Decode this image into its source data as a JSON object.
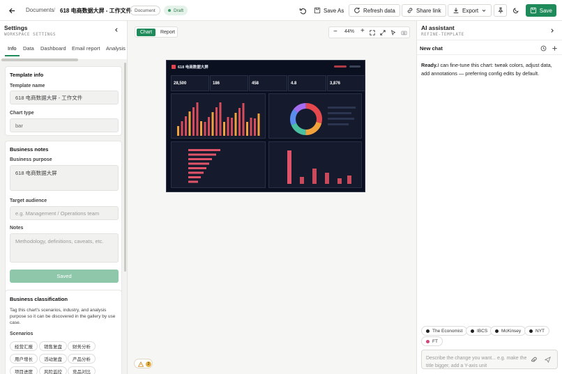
{
  "topbar": {
    "breadcrumb_root": "Documents",
    "separator": "/",
    "doc_title": "618 电商数据大屏 - 工作文件",
    "doc_type_badge": "Document",
    "status_badge": "Draft",
    "save_as_label": "Save As",
    "refresh_label": "Refresh data",
    "share_label": "Share link",
    "export_label": "Export",
    "save_label": "Save"
  },
  "left_panel": {
    "title": "Settings",
    "subtitle": "WORKSPACE SETTINGS",
    "tabs": [
      "Info",
      "Data",
      "Dashboard",
      "Email report",
      "Analysis"
    ],
    "template_info": {
      "heading": "Template info",
      "name_label": "Template name",
      "name_value": "618 电商数据大屏 - 工作文件",
      "type_label": "Chart type",
      "type_value": "bar"
    },
    "business_notes": {
      "heading": "Business notes",
      "purpose_label": "Business purpose",
      "purpose_value": "618 电商数据大屏",
      "audience_label": "Target audience",
      "audience_placeholder": "e.g. Management / Operations team",
      "notes_label": "Notes",
      "notes_placeholder": "Methodology, definitions, caveats, etc.",
      "saved_label": "Saved"
    },
    "classification": {
      "heading": "Business classification",
      "description": "Tag this chart's scenarios, industry, and analysis purpose so it can be discovered in the gallery by use case.",
      "scenarios_label": "Scenarios",
      "scenarios": [
        "经营汇报",
        "销售复盘",
        "财务分析",
        "用户增长",
        "活动复盘",
        "产品分析",
        "项目进度",
        "风险监控",
        "竞品对比"
      ]
    }
  },
  "canvas": {
    "view_tabs": [
      "Chart",
      "Report"
    ],
    "active_view": "Chart",
    "zoom": "44%",
    "issue_count": "2",
    "dashboard": {
      "title": "618 电商数据大屏",
      "kpis": [
        "28,500",
        "186",
        "458",
        "4.8",
        "3,876"
      ]
    }
  },
  "assistant": {
    "title": "AI assistant",
    "subtitle": "REFINE-TEMPLATE",
    "new_chat_label": "New chat",
    "ready_label": "Ready.",
    "message": "I can fine-tune this chart: tweak colors, adjust data, add annotations — preferring config edits by default.",
    "styles": [
      "The Economist",
      "IBCS",
      "McKinsey",
      "NYT",
      "FT"
    ],
    "input_placeholder": "Describe the change you want... e.g. make the title bigger, add a Y-axis unit"
  }
}
